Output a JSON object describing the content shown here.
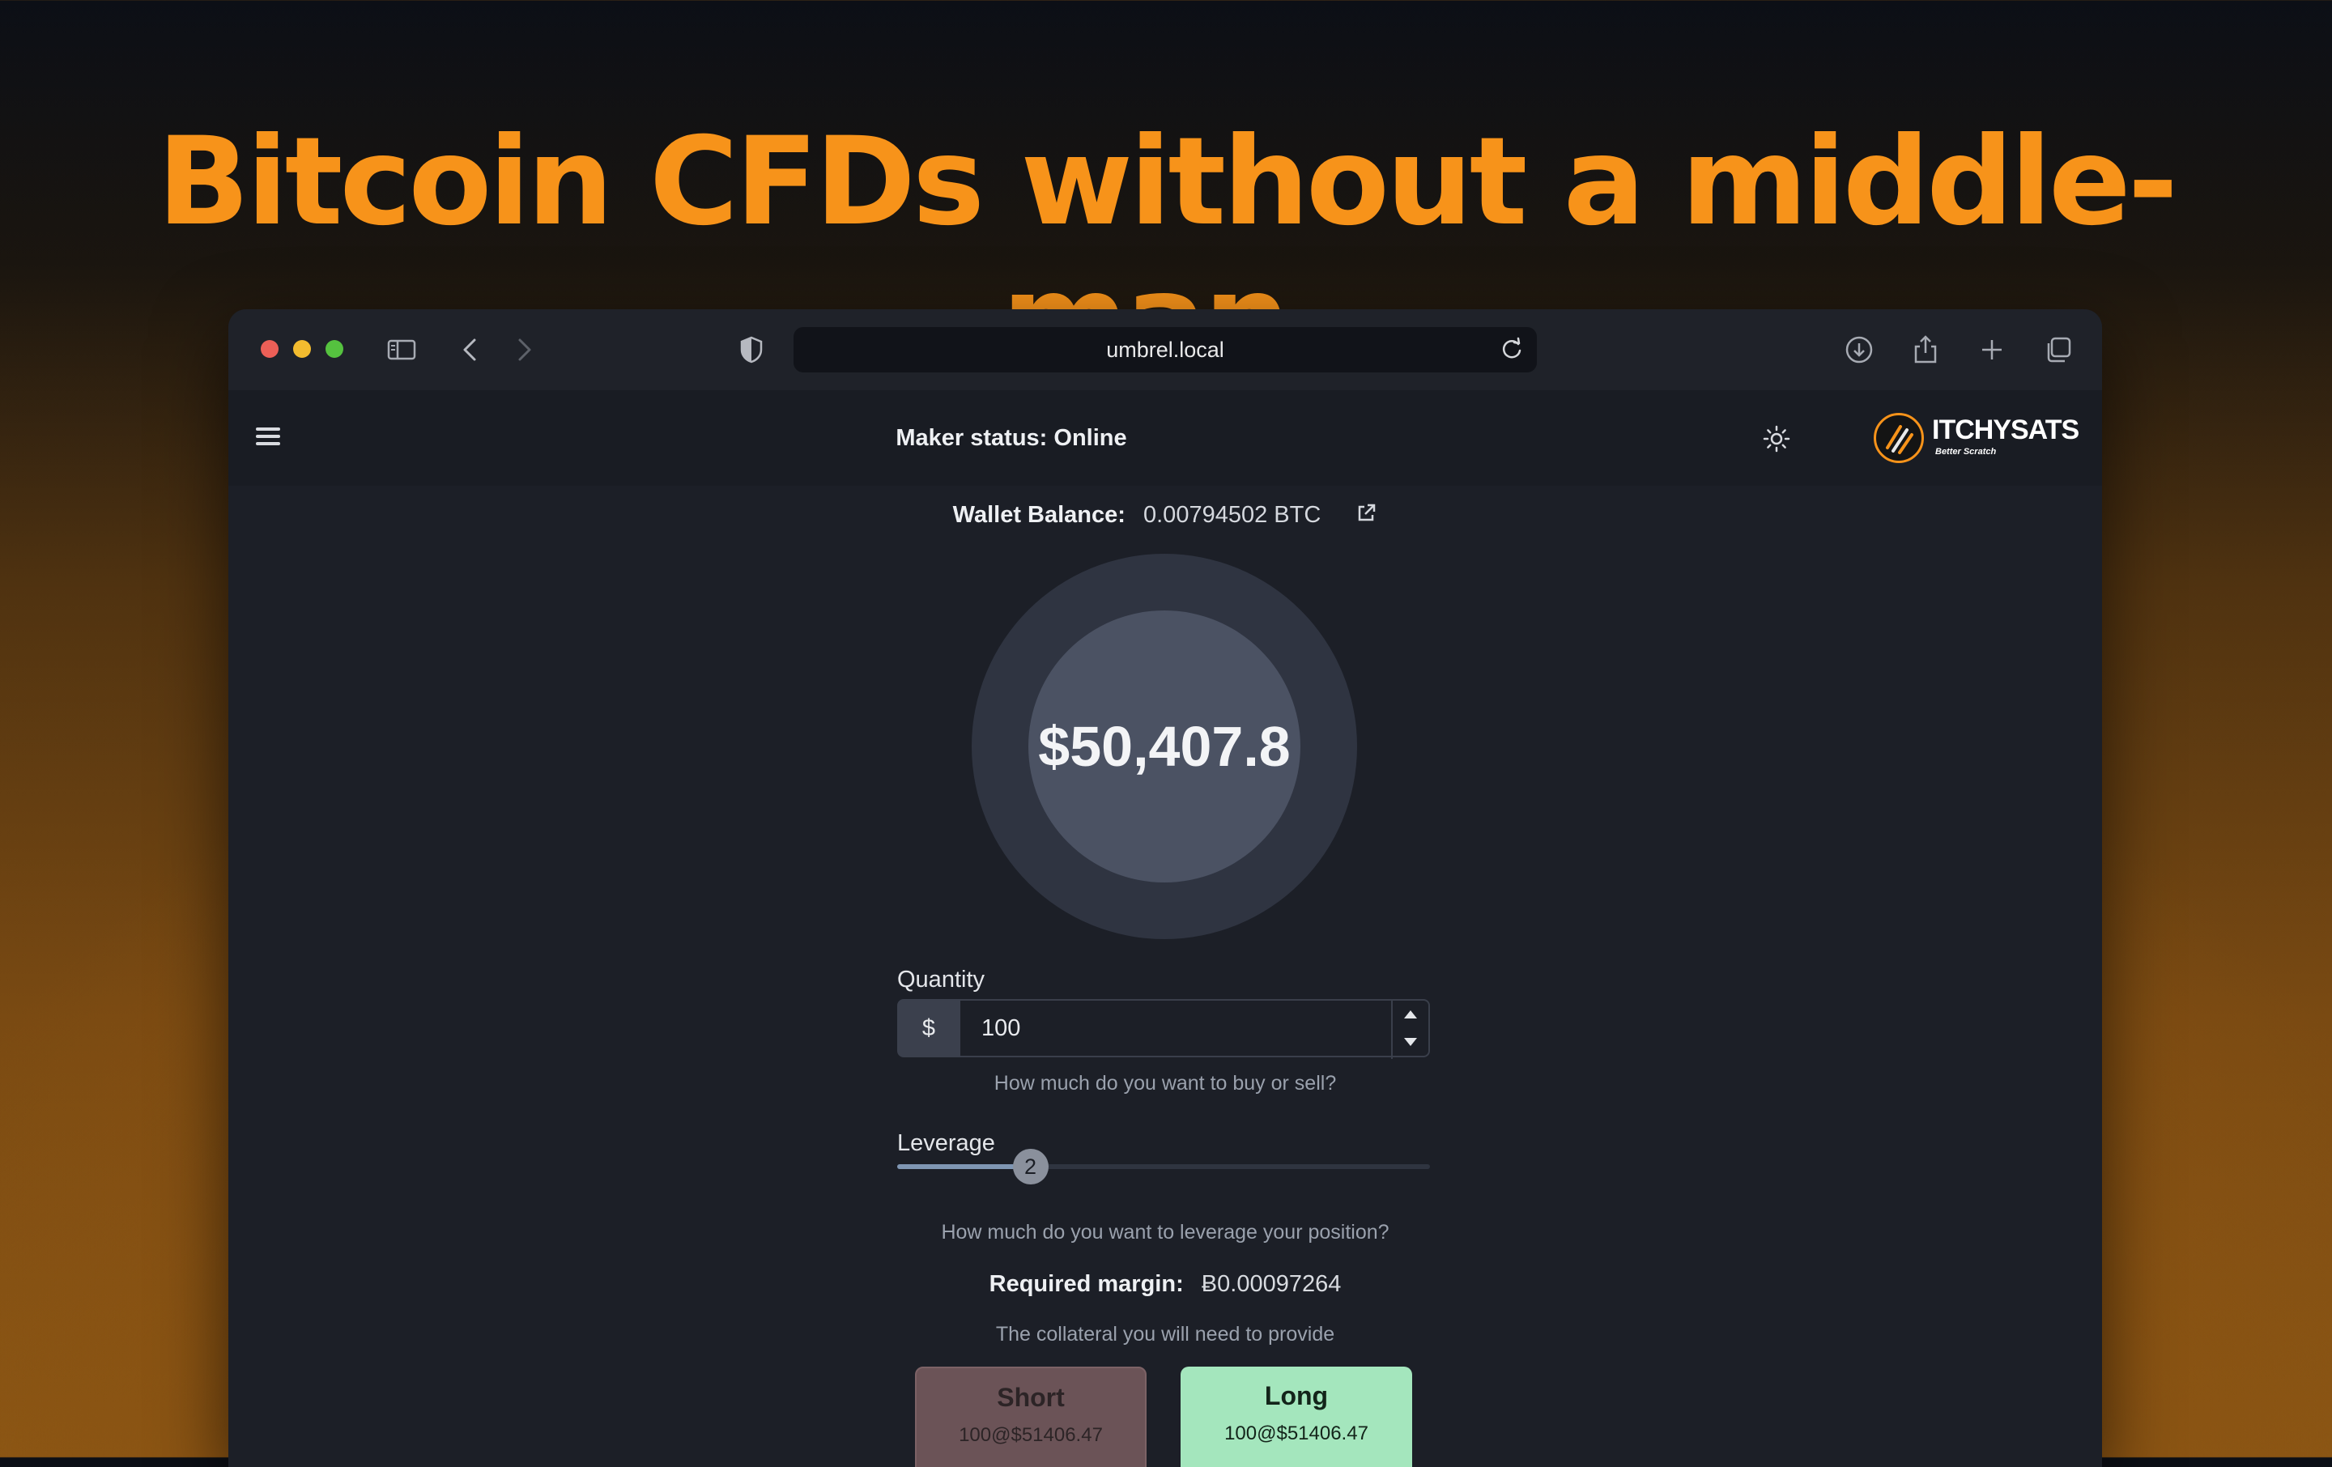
{
  "headline": "Bitcoin CFDs without a middle-man.",
  "browser": {
    "url": "umbrel.local"
  },
  "app": {
    "maker_status": "Maker status: Online",
    "logo_text": "ITCHYSATS",
    "logo_subtitle": "Better Scratch"
  },
  "wallet": {
    "label": "Wallet Balance:",
    "value": "0.00794502 BTC"
  },
  "price": "$50,407.8",
  "quantity": {
    "label": "Quantity",
    "prefix": "$",
    "value": "100",
    "help": "How much do you want to buy or sell?"
  },
  "leverage": {
    "label": "Leverage",
    "value": "2",
    "fill_fraction": 0.25,
    "help": "How much do you want to leverage your position?"
  },
  "margin": {
    "label": "Required margin:",
    "value": "Ƀ0.00097264",
    "help": "The collateral you will need to provide"
  },
  "actions": {
    "short_label": "Short",
    "short_sub": "100@$51406.47",
    "long_label": "Long",
    "long_sub": "100@$51406.47"
  },
  "colors": {
    "accent": "#f7931a",
    "long": "#a4e6bd",
    "short": "#6b5357"
  }
}
